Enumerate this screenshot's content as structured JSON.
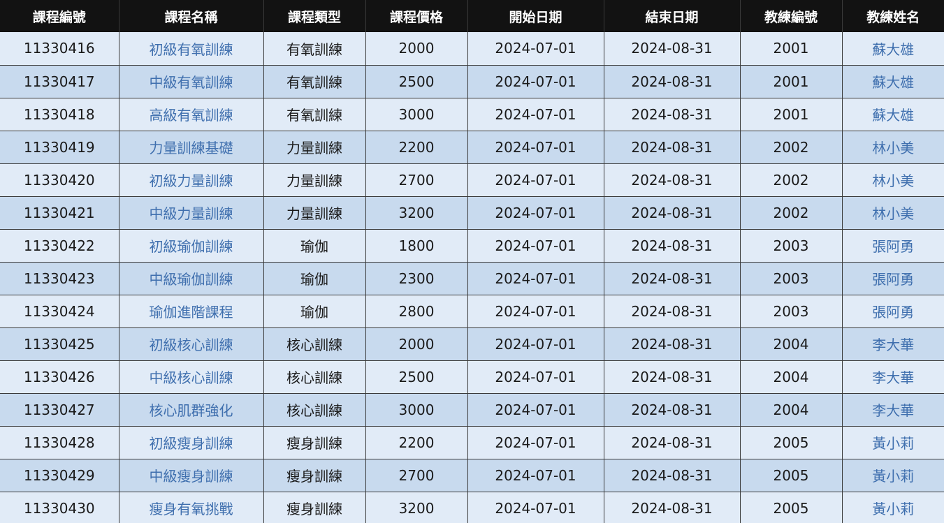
{
  "table": {
    "headers": [
      "課程編號",
      "課程名稱",
      "課程類型",
      "課程價格",
      "開始日期",
      "結束日期",
      "教練編號",
      "教練姓名"
    ],
    "rows": [
      {
        "id": "11330416",
        "name": "初級有氧訓練",
        "type": "有氧訓練",
        "price": "2000",
        "start": "2024-07-01",
        "end": "2024-08-31",
        "coach_id": "2001",
        "coach_name": "蘇大雄"
      },
      {
        "id": "11330417",
        "name": "中級有氧訓練",
        "type": "有氧訓練",
        "price": "2500",
        "start": "2024-07-01",
        "end": "2024-08-31",
        "coach_id": "2001",
        "coach_name": "蘇大雄"
      },
      {
        "id": "11330418",
        "name": "高級有氧訓練",
        "type": "有氧訓練",
        "price": "3000",
        "start": "2024-07-01",
        "end": "2024-08-31",
        "coach_id": "2001",
        "coach_name": "蘇大雄"
      },
      {
        "id": "11330419",
        "name": "力量訓練基礎",
        "type": "力量訓練",
        "price": "2200",
        "start": "2024-07-01",
        "end": "2024-08-31",
        "coach_id": "2002",
        "coach_name": "林小美"
      },
      {
        "id": "11330420",
        "name": "初級力量訓練",
        "type": "力量訓練",
        "price": "2700",
        "start": "2024-07-01",
        "end": "2024-08-31",
        "coach_id": "2002",
        "coach_name": "林小美"
      },
      {
        "id": "11330421",
        "name": "中級力量訓練",
        "type": "力量訓練",
        "price": "3200",
        "start": "2024-07-01",
        "end": "2024-08-31",
        "coach_id": "2002",
        "coach_name": "林小美"
      },
      {
        "id": "11330422",
        "name": "初級瑜伽訓練",
        "type": "瑜伽",
        "price": "1800",
        "start": "2024-07-01",
        "end": "2024-08-31",
        "coach_id": "2003",
        "coach_name": "張阿勇"
      },
      {
        "id": "11330423",
        "name": "中級瑜伽訓練",
        "type": "瑜伽",
        "price": "2300",
        "start": "2024-07-01",
        "end": "2024-08-31",
        "coach_id": "2003",
        "coach_name": "張阿勇"
      },
      {
        "id": "11330424",
        "name": "瑜伽進階課程",
        "type": "瑜伽",
        "price": "2800",
        "start": "2024-07-01",
        "end": "2024-08-31",
        "coach_id": "2003",
        "coach_name": "張阿勇"
      },
      {
        "id": "11330425",
        "name": "初級核心訓練",
        "type": "核心訓練",
        "price": "2000",
        "start": "2024-07-01",
        "end": "2024-08-31",
        "coach_id": "2004",
        "coach_name": "李大華"
      },
      {
        "id": "11330426",
        "name": "中級核心訓練",
        "type": "核心訓練",
        "price": "2500",
        "start": "2024-07-01",
        "end": "2024-08-31",
        "coach_id": "2004",
        "coach_name": "李大華"
      },
      {
        "id": "11330427",
        "name": "核心肌群強化",
        "type": "核心訓練",
        "price": "3000",
        "start": "2024-07-01",
        "end": "2024-08-31",
        "coach_id": "2004",
        "coach_name": "李大華"
      },
      {
        "id": "11330428",
        "name": "初級瘦身訓練",
        "type": "瘦身訓練",
        "price": "2200",
        "start": "2024-07-01",
        "end": "2024-08-31",
        "coach_id": "2005",
        "coach_name": "黃小莉"
      },
      {
        "id": "11330429",
        "name": "中級瘦身訓練",
        "type": "瘦身訓練",
        "price": "2700",
        "start": "2024-07-01",
        "end": "2024-08-31",
        "coach_id": "2005",
        "coach_name": "黃小莉"
      },
      {
        "id": "11330430",
        "name": "瘦身有氧挑戰",
        "type": "瘦身訓練",
        "price": "3200",
        "start": "2024-07-01",
        "end": "2024-08-31",
        "coach_id": "2005",
        "coach_name": "黃小莉"
      }
    ]
  },
  "colors": {
    "header_bg": "#121212",
    "header_text": "#ffffff",
    "row_light": "#e1ebf7",
    "row_dark": "#c8daee",
    "link_text": "#3f6fae"
  }
}
